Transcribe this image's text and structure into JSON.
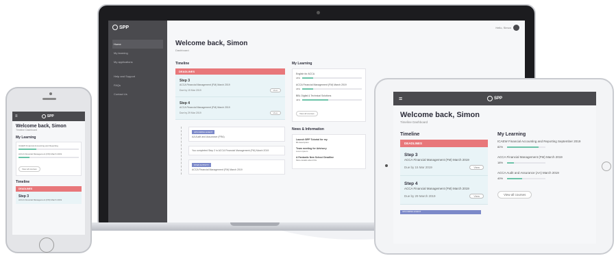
{
  "brand": {
    "logo_text": "SPP"
  },
  "laptop": {
    "user_name": "Hello, Simon",
    "sidebar": [
      {
        "label": "Home",
        "active": true
      },
      {
        "label": "My learning",
        "active": false
      },
      {
        "label": "My applications",
        "active": false
      },
      {
        "label": "Help and Support",
        "active": false,
        "gap": true
      },
      {
        "label": "FAQs",
        "active": false
      },
      {
        "label": "Contact Us",
        "active": false
      }
    ],
    "title": "Welcome back, Simon",
    "subtitle": "Dashboard",
    "timeline_heading": "Timeline",
    "deadlines_label": "DEADLINES",
    "deadlines": [
      {
        "step": "Step 3",
        "course": "ACCA Financial Management (FM) March 2019",
        "due": "Due by 15 Mar 2019",
        "action": "View"
      },
      {
        "step": "Step 4",
        "course": "ACCA Financial Management (FM) March 2019",
        "due": "Due by 29 Mar 2019",
        "action": "View"
      }
    ],
    "timeline_items": [
      {
        "tag": "UPCOMING EVENT",
        "text": "AA Audit and Assurance (FRA)"
      },
      {
        "tag": "",
        "text": "You completed Step 2 in ACCA Financial Management (FM) March 2019"
      },
      {
        "tag": "STEP ACTIVITY",
        "text": "ACCA Financial Management (FM) March 2019"
      }
    ],
    "my_learning_heading": "My Learning",
    "my_learning": [
      {
        "name": "English for ACCA",
        "pct": "18%",
        "progress": 18
      },
      {
        "name": "ACCA Financial Management (FM) March 2019",
        "pct": "18%",
        "progress": 18
      },
      {
        "name": "BBL Digital & Technical Solutions",
        "pct": "44%",
        "progress": 44
      }
    ],
    "view_all_label": "View all courses",
    "news_heading": "News & Information",
    "news": [
      {
        "title": "Launch BPP Tutorial for my",
        "body": "Bit description"
      },
      {
        "title": "Team meeting for Advisory",
        "body": "Lorem ipsum"
      },
      {
        "title": "A Fantastic New School Deadline",
        "body": "More details about this"
      }
    ]
  },
  "phone": {
    "title": "Welcome back, Simon",
    "subtitle": "Timeline Dashboard",
    "my_learning_heading": "My Learning",
    "my_learning": [
      {
        "name": "ICAEW Financial Accounting and Reporting",
        "progress": 30
      },
      {
        "name": "ACCA Financial Management (FM) March 2019",
        "progress": 18
      }
    ],
    "view_all_label": "View all courses",
    "timeline_heading": "Timeline",
    "deadlines_label": "DEADLINES",
    "step": "Step 3",
    "course": "ACCA Financial Management (FM) March 2019"
  },
  "tablet": {
    "title": "Welcome back, Simon",
    "subtitle": "Timeline Dashboard",
    "timeline_heading": "Timeline",
    "deadlines_label": "DEADLINES",
    "deadlines": [
      {
        "step": "Step 3",
        "course": "ACCA Financial Management (FM) March 2019",
        "due": "Due by 15 Mar 2019",
        "action": "View"
      },
      {
        "step": "Step 4",
        "course": "ACCA Financial Management (FM) March 2019",
        "due": "Due by 29 March 2019",
        "action": "View"
      }
    ],
    "upcoming_label": "UPCOMING EVENT",
    "my_learning_heading": "My Learning",
    "my_learning": [
      {
        "name": "ICAEW Financial Accounting and Reporting September 2019",
        "pct": "82%",
        "progress": 82
      },
      {
        "name": "ACCA Financial Management (FM) March 2019",
        "pct": "18%",
        "progress": 18
      },
      {
        "name": "ACCA Audit and Assurance (AA) March 2019",
        "pct": "40%",
        "progress": 40
      }
    ],
    "view_all_label": "View all courses"
  }
}
